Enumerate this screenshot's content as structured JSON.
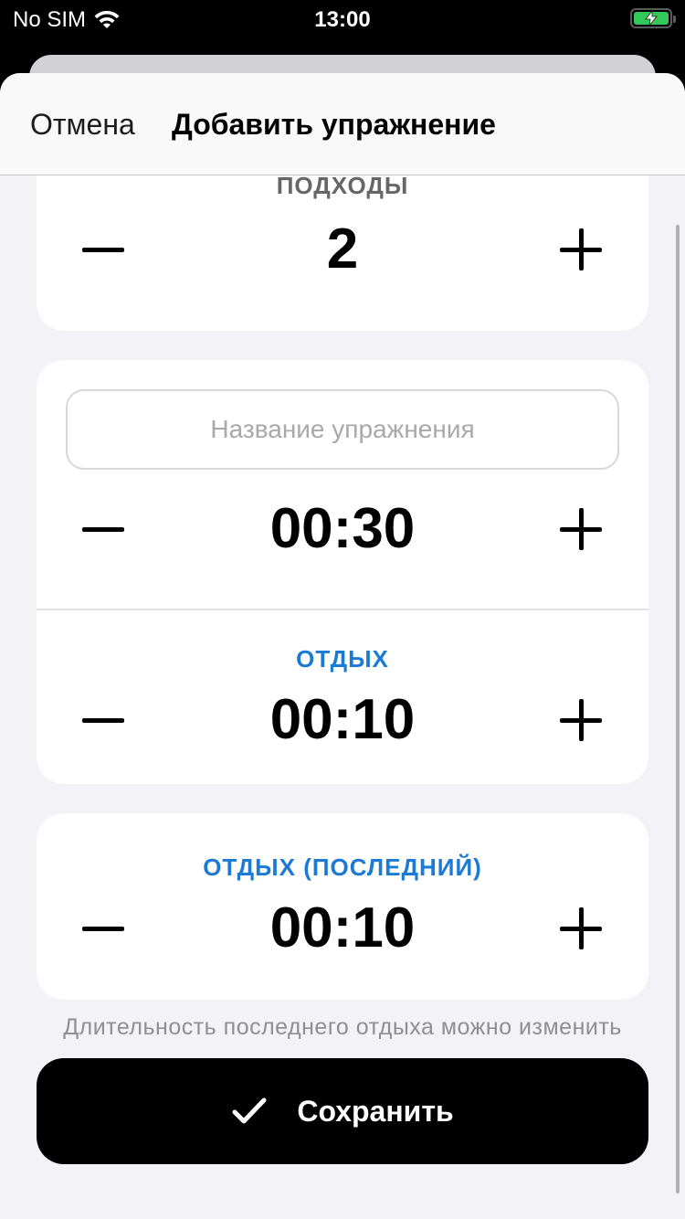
{
  "status_bar": {
    "carrier": "No SIM",
    "time": "13:00",
    "battery_color": "#34c759"
  },
  "nav": {
    "cancel_label": "Отмена",
    "title": "Добавить упражнение"
  },
  "sets": {
    "label": "ПОДХОДЫ",
    "value": "2"
  },
  "exercise": {
    "name_placeholder": "Название упражнения",
    "name_value": "",
    "duration": "00:30"
  },
  "rest": {
    "label": "ОТДЫХ",
    "value": "00:10"
  },
  "last_rest": {
    "label": "ОТДЫХ (ПОСЛЕДНИЙ)",
    "value": "00:10"
  },
  "hint": "Длительность последнего отдыха можно изменить",
  "save": {
    "label": "Сохранить",
    "icon": "checkmark-icon"
  },
  "colors": {
    "accent_blue": "#1a7ad6",
    "background": "#f2f2f7"
  }
}
